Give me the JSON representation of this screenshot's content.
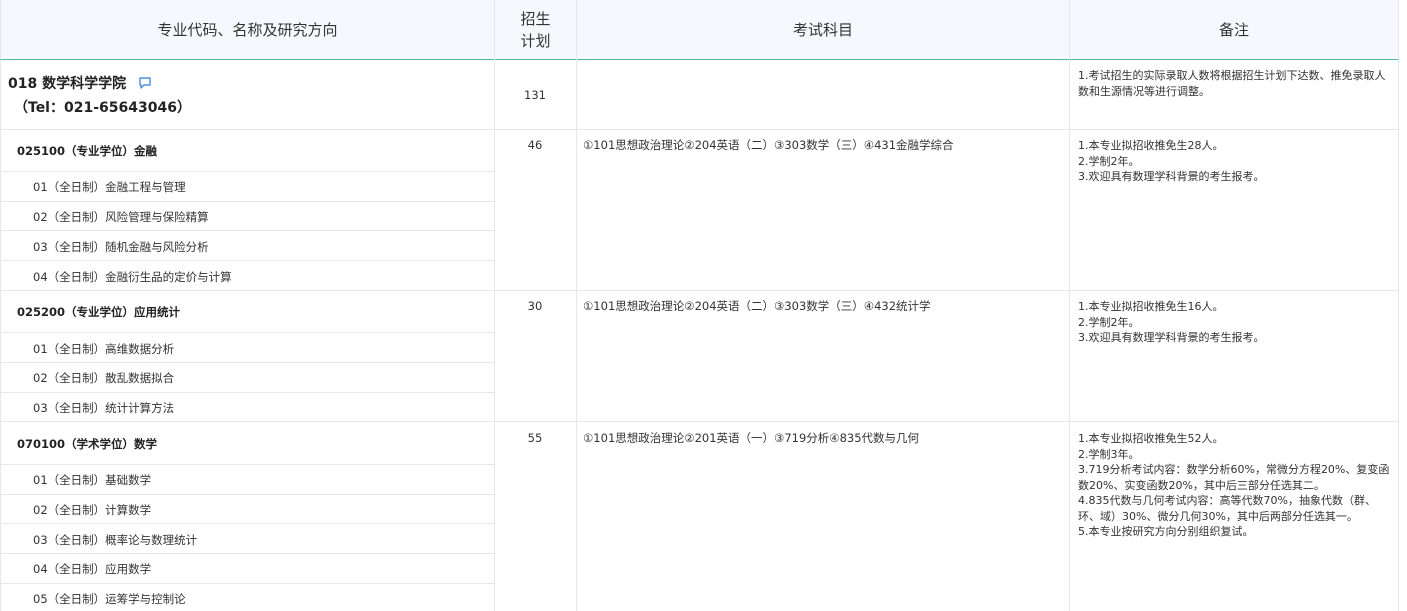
{
  "header": {
    "col_major": "专业代码、名称及研究方向",
    "col_quota_line1": "招生",
    "col_quota_line2": "计划",
    "col_subjects": "考试科目",
    "col_notes": "备注"
  },
  "dept": {
    "name": "018 数学科学学院",
    "tel": "（Tel：021-65643046）",
    "quota": "131",
    "notes": [
      "1.考试招生的实际录取人数将根据招生计划下达数、推免录取人",
      "数和生源情况等进行调整。"
    ]
  },
  "majors": [
    {
      "title": "025100（专业学位）金融",
      "quota": "46",
      "subjects": "①101思想政治理论②204英语（二）③303数学（三）④431金融学综合",
      "directions": [
        "01（全日制）金融工程与管理",
        "02（全日制）风险管理与保险精算",
        "03（全日制）随机金融与风险分析",
        "04（全日制）金融衍生品的定价与计算"
      ],
      "notes": [
        "1.本专业拟招收推免生28人。",
        "2.学制2年。",
        "3.欢迎具有数理学科背景的考生报考。"
      ]
    },
    {
      "title": "025200（专业学位）应用统计",
      "quota": "30",
      "subjects": "①101思想政治理论②204英语（二）③303数学（三）④432统计学",
      "directions": [
        "01（全日制）高维数据分析",
        "02（全日制）散乱数据拟合",
        "03（全日制）统计计算方法"
      ],
      "notes": [
        "1.本专业拟招收推免生16人。",
        "2.学制2年。",
        "3.欢迎具有数理学科背景的考生报考。"
      ]
    },
    {
      "title": "070100（学术学位）数学",
      "quota": "55",
      "subjects": "①101思想政治理论②201英语（一）③719分析④835代数与几何",
      "directions": [
        "01（全日制）基础数学",
        "02（全日制）计算数学",
        "03（全日制）概率论与数理统计",
        "04（全日制）应用数学",
        "05（全日制）运筹学与控制论"
      ],
      "notes": [
        "1.本专业拟招收推免生52人。",
        "2.学制3年。",
        "3.719分析考试内容：数学分析60%，常微分方程20%、复变函",
        "数20%、实变函数20%，其中后三部分任选其二。",
        "4.835代数与几何考试内容：高等代数70%，抽象代数（群、",
        "环、域）30%、微分几何30%，其中后两部分任选其一。",
        "5.本专业按研究方向分别组织复试。"
      ]
    }
  ],
  "colors": {
    "header_bg": "#f5f8fc",
    "header_border": "#4fb6a8",
    "grid": "#e4e7ec",
    "icon": "#4a90e2"
  }
}
